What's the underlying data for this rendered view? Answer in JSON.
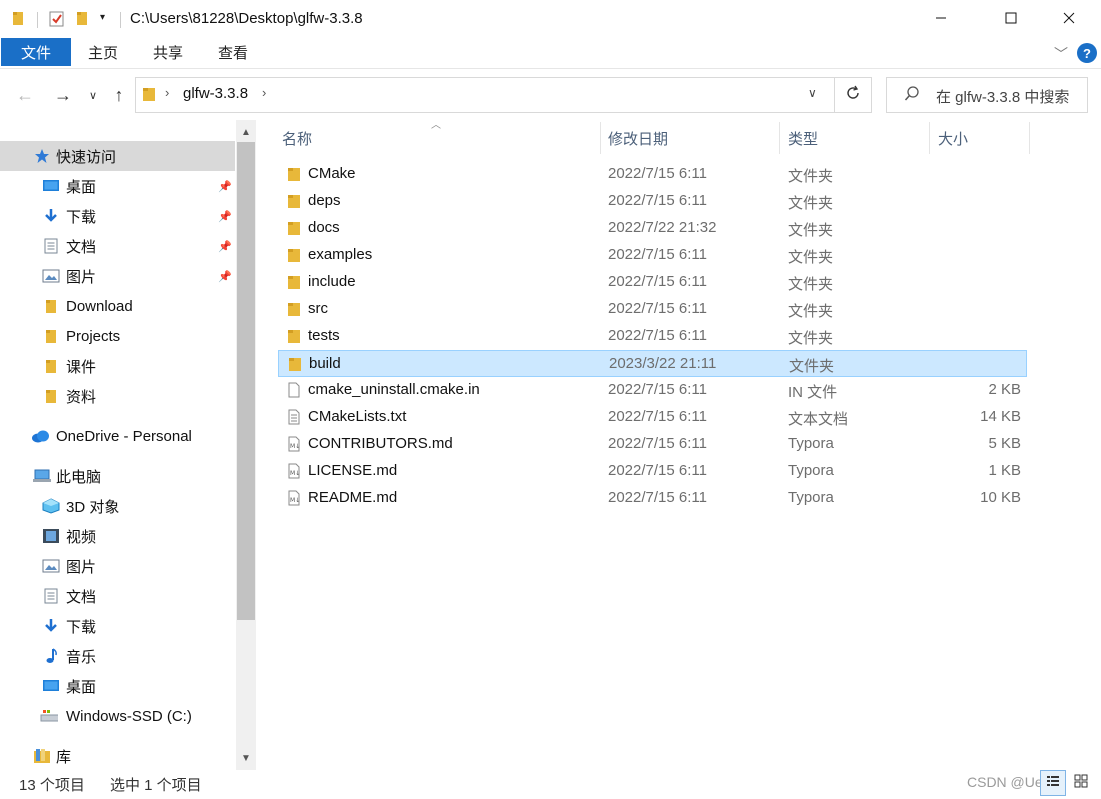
{
  "title_bar": {
    "path": "C:\\Users\\81228\\Desktop\\glfw-3.3.8",
    "minimize_icon": "minimize-icon",
    "maximize_icon": "maximize-icon",
    "close_icon": "close-icon"
  },
  "ribbon": {
    "tabs": [
      "文件",
      "主页",
      "共享",
      "查看"
    ],
    "accent": "#1a6fc7"
  },
  "address_bar": {
    "crumb": "glfw-3.3.8",
    "search_placeholder": "在 glfw-3.3.8 中搜索"
  },
  "nav_pane": {
    "items": [
      {
        "label": "快速访问",
        "icon": "star-icon",
        "selected": true
      },
      {
        "label": "桌面",
        "icon": "desktop-icon",
        "pinned": true
      },
      {
        "label": "下载",
        "icon": "download-icon",
        "pinned": true
      },
      {
        "label": "文档",
        "icon": "document-icon",
        "pinned": true
      },
      {
        "label": "图片",
        "icon": "picture-icon",
        "pinned": true
      },
      {
        "label": "Download",
        "icon": "folder-icon"
      },
      {
        "label": "Projects",
        "icon": "folder-icon"
      },
      {
        "label": "课件",
        "icon": "folder-icon"
      },
      {
        "label": "资料",
        "icon": "folder-icon"
      },
      {
        "label": "OneDrive - Personal",
        "icon": "cloud-icon"
      },
      {
        "label": "此电脑",
        "icon": "computer-icon"
      },
      {
        "label": "3D 对象",
        "icon": "3d-objects-icon"
      },
      {
        "label": "视频",
        "icon": "video-icon"
      },
      {
        "label": "图片",
        "icon": "picture-icon"
      },
      {
        "label": "文档",
        "icon": "document-icon"
      },
      {
        "label": "下载",
        "icon": "download-icon"
      },
      {
        "label": "音乐",
        "icon": "music-icon"
      },
      {
        "label": "桌面",
        "icon": "desktop-icon"
      },
      {
        "label": "Windows-SSD (C:)",
        "icon": "drive-icon"
      },
      {
        "label": "库",
        "icon": "library-icon"
      }
    ]
  },
  "file_list": {
    "columns": [
      "名称",
      "修改日期",
      "类型",
      "大小"
    ],
    "rows": [
      {
        "name": "CMake",
        "date": "2022/7/15 6:11",
        "type": "文件夹",
        "size": "",
        "icon": "folder-icon"
      },
      {
        "name": "deps",
        "date": "2022/7/15 6:11",
        "type": "文件夹",
        "size": "",
        "icon": "folder-icon"
      },
      {
        "name": "docs",
        "date": "2022/7/22 21:32",
        "type": "文件夹",
        "size": "",
        "icon": "folder-icon"
      },
      {
        "name": "examples",
        "date": "2022/7/15 6:11",
        "type": "文件夹",
        "size": "",
        "icon": "folder-icon"
      },
      {
        "name": "include",
        "date": "2022/7/15 6:11",
        "type": "文件夹",
        "size": "",
        "icon": "folder-icon"
      },
      {
        "name": "src",
        "date": "2022/7/15 6:11",
        "type": "文件夹",
        "size": "",
        "icon": "folder-icon"
      },
      {
        "name": "tests",
        "date": "2022/7/15 6:11",
        "type": "文件夹",
        "size": "",
        "icon": "folder-icon"
      },
      {
        "name": "build",
        "date": "2023/3/22 21:11",
        "type": "文件夹",
        "size": "",
        "icon": "folder-icon",
        "selected": true
      },
      {
        "name": "cmake_uninstall.cmake.in",
        "date": "2022/7/15 6:11",
        "type": "IN 文件",
        "size": "2 KB",
        "icon": "file-icon"
      },
      {
        "name": "CMakeLists.txt",
        "date": "2022/7/15 6:11",
        "type": "文本文档",
        "size": "14 KB",
        "icon": "text-file-icon"
      },
      {
        "name": "CONTRIBUTORS.md",
        "date": "2022/7/15 6:11",
        "type": "Typora",
        "size": "5 KB",
        "icon": "markdown-file-icon"
      },
      {
        "name": "LICENSE.md",
        "date": "2022/7/15 6:11",
        "type": "Typora",
        "size": "1 KB",
        "icon": "markdown-file-icon"
      },
      {
        "name": "README.md",
        "date": "2022/7/15 6:11",
        "type": "Typora",
        "size": "10 KB",
        "icon": "markdown-file-icon"
      }
    ]
  },
  "status_bar": {
    "item_count": "13 个项目",
    "selected_count": "选中 1 个项目",
    "watermark": "CSDN @Ue..."
  }
}
